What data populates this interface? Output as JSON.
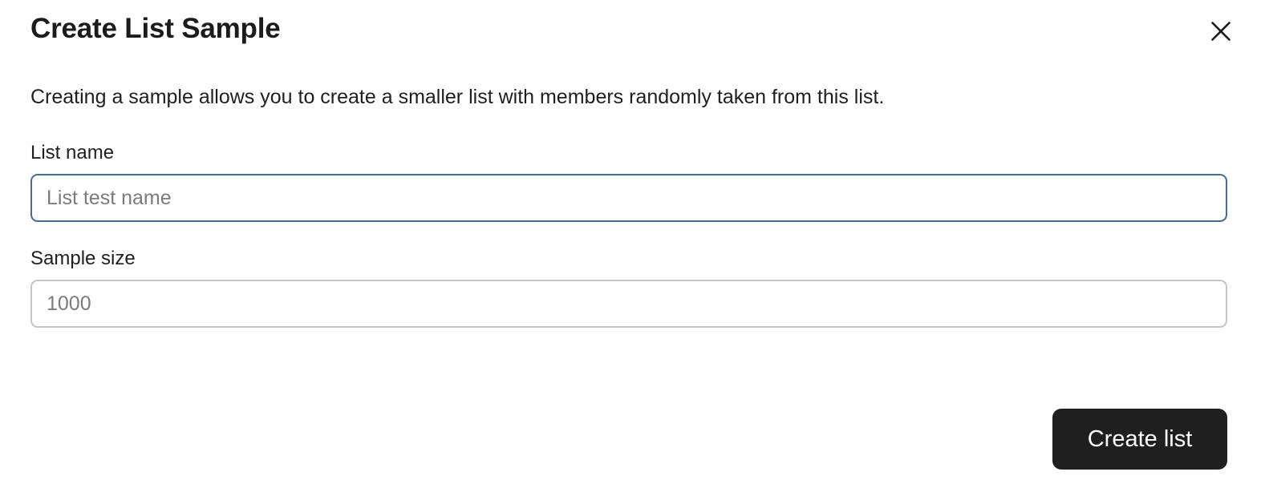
{
  "dialog": {
    "title": "Create List Sample",
    "description": "Creating a sample allows you to create a smaller list with members randomly taken from this list.",
    "close_icon": "close-icon",
    "close_label": "Close"
  },
  "form": {
    "fields": [
      {
        "label": "List name",
        "placeholder": "List test name",
        "value": "",
        "focused": true
      },
      {
        "label": "Sample size",
        "placeholder": "1000",
        "value": "",
        "focused": false
      }
    ]
  },
  "footer": {
    "submit_label": "Create list"
  },
  "colors": {
    "background": "#ffffff",
    "text": "#1f1f1f",
    "placeholder": "#7b7b7b",
    "border_default": "#c5c5c5",
    "border_focus": "#4a6a8f",
    "button_background": "#1f1f1f",
    "button_text": "#ffffff"
  }
}
